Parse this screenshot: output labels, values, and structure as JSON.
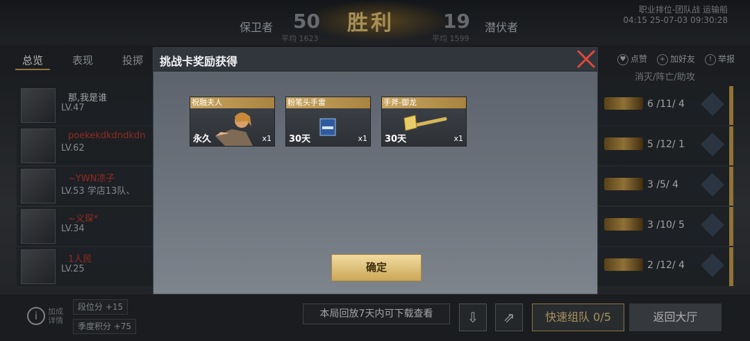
{
  "scoreboard": {
    "victory": "胜利",
    "left_team": "保卫者",
    "left_score": "50",
    "left_avg": "平均 1623",
    "right_team": "潜伏者",
    "right_score": "19",
    "right_avg": "平均 1599",
    "mode": "职业排位-团队战 运输船",
    "time": "04:15 25-07-03 09:30:28"
  },
  "tabs": [
    "总览",
    "表现",
    "投掷"
  ],
  "actions": [
    "点赞",
    "加好友",
    "举报"
  ],
  "column_header": "消灭/阵亡/助攻",
  "players": [
    {
      "name": "那,我是谁",
      "level": "LV.47"
    },
    {
      "name": "poekekdkdndkdn",
      "level": "LV.62"
    },
    {
      "name": "~YWN凉子",
      "level": "LV.53 学店13队、"
    },
    {
      "name": "~义琛*",
      "level": "LV.34"
    },
    {
      "name": "1人民",
      "level": "LV.25"
    }
  ],
  "stats": [
    "6 /11/ 4",
    "5 /12/ 1",
    "3 /5/ 4",
    "3 /10/ 5",
    "2 /12/ 4"
  ],
  "bottom": {
    "info_label": "加成详情",
    "rank_points": "段位分 +15",
    "season_points": "季度积分 +75",
    "replay": "本局回放7天内可下载查看",
    "fast_team": "快速组队 0/5",
    "back": "返回大厅"
  },
  "modal": {
    "title": "挑战卡奖励获得",
    "rewards": [
      {
        "name": "祝融夫人",
        "duration": "永久",
        "qty": "x1"
      },
      {
        "name": "粉笔头手雷",
        "duration": "30天",
        "qty": "x1"
      },
      {
        "name": "手斧-御龙",
        "duration": "30天",
        "qty": "x1"
      }
    ],
    "confirm": "确定"
  },
  "colors": {
    "accent_gold": "#caa04d",
    "close_red": "#e0483c"
  }
}
